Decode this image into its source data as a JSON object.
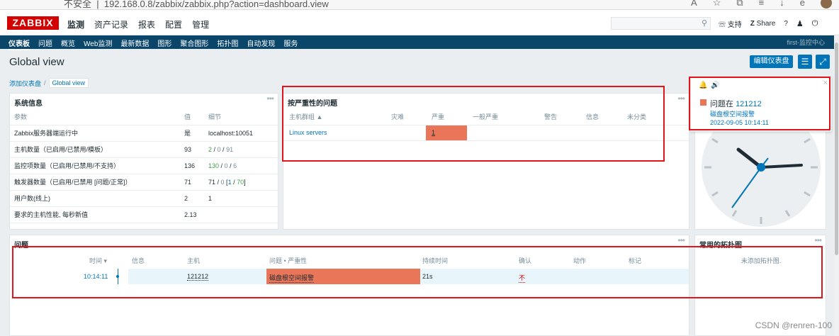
{
  "browser": {
    "security_label": "不安全",
    "url": "192.168.0.8/zabbix/zabbix.php?action=dashboard.view"
  },
  "header": {
    "logo": "ZABBIX",
    "menu": [
      "监测",
      "资产记录",
      "报表",
      "配置",
      "管理"
    ],
    "active_menu": "监测",
    "support": "支持",
    "share": "Share",
    "help": "?"
  },
  "subnav": {
    "items": [
      "仪表板",
      "问题",
      "概览",
      "Web监测",
      "最新数据",
      "图形",
      "聚合图形",
      "拓扑图",
      "自动发现",
      "服务"
    ],
    "server_name": "first-监控中心"
  },
  "page": {
    "title": "Global view",
    "edit_button": "编辑仪表盘"
  },
  "breadcrumb": {
    "parent": "添加仪表盘",
    "current": "Global view"
  },
  "sysinfo": {
    "title": "系统信息",
    "headers": [
      "参数",
      "值",
      "细节"
    ],
    "rows": [
      {
        "param": "Zabbix服务器端运行中",
        "value": "是",
        "detail": "localhost:10051"
      },
      {
        "param": "主机数量（已启用/已禁用/模板）",
        "value": "93",
        "d1": "2",
        "d2": "0",
        "d3": "91"
      },
      {
        "param": "监控项数量（已启用/已禁用/不支持）",
        "value": "136",
        "d1": "130",
        "d2": "0",
        "d3": "6"
      },
      {
        "param": "触发器数量（已启用/已禁用 [问题/正常]）",
        "value": "71",
        "d1": "71",
        "d2": "0",
        "d3": "1",
        "d4": "70"
      },
      {
        "param": "用户数(线上)",
        "value": "2",
        "d1": "1"
      },
      {
        "param": "要求的主机性能, 每秒新值",
        "value": "2.13"
      }
    ]
  },
  "severity": {
    "title": "按严重性的问题",
    "headers": [
      "主机群组 ▲",
      "灾难",
      "严重",
      "一般严重",
      "警告",
      "信息",
      "未分类"
    ],
    "rows": [
      {
        "group": "Linux servers",
        "disaster": "",
        "high": "1",
        "average": "",
        "warning": "",
        "info": "",
        "not_classified": ""
      }
    ]
  },
  "problems": {
    "title": "问题",
    "headers": {
      "time": "时间 ▾",
      "info": "信息",
      "host": "主机",
      "problem": "问题 • 严重性",
      "duration": "持续时间",
      "ack": "确认",
      "actions": "动作",
      "tags": "标记"
    },
    "rows": [
      {
        "time": "10:14:11",
        "host": "121212",
        "problem": "磁盘根空间报警",
        "duration": "21s",
        "ack": "不"
      }
    ]
  },
  "maps": {
    "title": "常用的拓扑图",
    "empty_text": "未添加拓扑图."
  },
  "notification": {
    "prefix": "问题在",
    "host": "121212",
    "problem": "磁盘根空间报警",
    "time": "2022-09-05 10:14:11"
  },
  "clock": {
    "time": "10:14:11"
  },
  "watermark": "CSDN @renren-100",
  "colors": {
    "brand": "#d40000",
    "nav": "#0a466a",
    "accent": "#0275b8",
    "high_severity": "#e97659",
    "annotation": "#e0151c"
  }
}
